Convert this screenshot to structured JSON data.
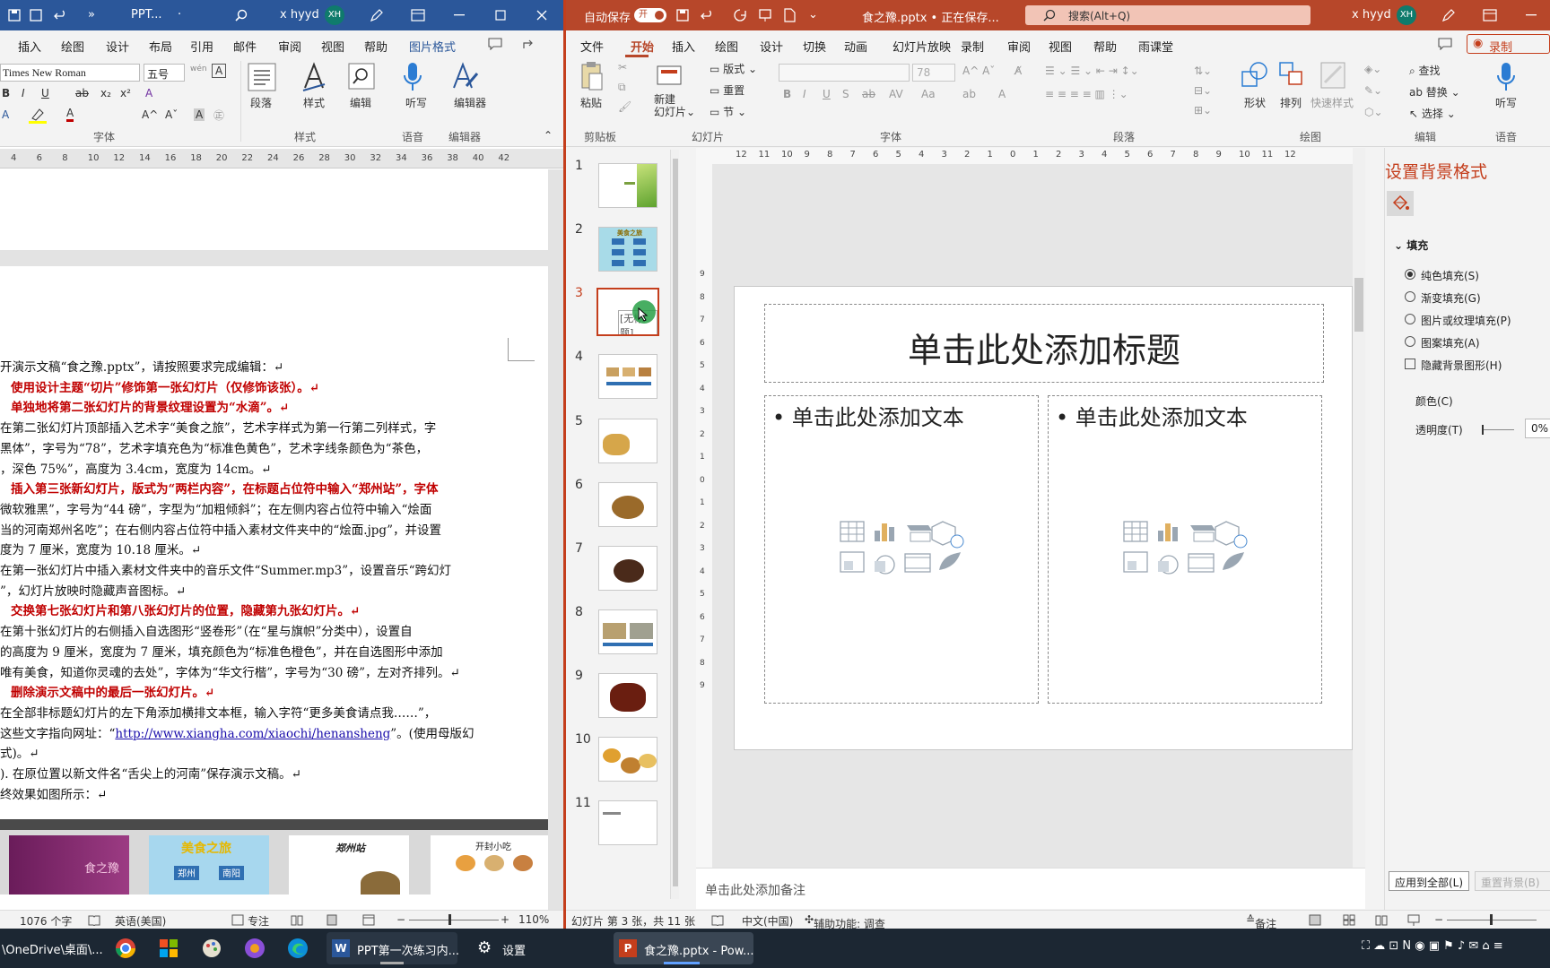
{
  "word": {
    "title": {
      "doc": "PPT...",
      "autosave_menu": "·",
      "user": "x hyyd",
      "avatar": "XH"
    },
    "menu": [
      "插入",
      "绘图",
      "设计",
      "布局",
      "引用",
      "邮件",
      "审阅",
      "视图",
      "帮助",
      "图片格式"
    ],
    "ribbon": {
      "font_name": "Times New Roman",
      "font_size": "五号",
      "groups": [
        "字体",
        "样式",
        "语音",
        "编辑器"
      ],
      "big_buttons": [
        "段落",
        "样式",
        "编辑",
        "听写",
        "编辑器"
      ],
      "tool_labels": [
        "B",
        "I",
        "U",
        "ab",
        "x₂",
        "x²",
        "A",
        "A",
        "A",
        "A"
      ]
    },
    "ruler": [
      "4",
      "6",
      "8",
      "10",
      "12",
      "14",
      "16",
      "18",
      "20",
      "22",
      "24",
      "26",
      "28",
      "30",
      "32",
      "34",
      "36",
      "38",
      "40",
      "42"
    ],
    "paragraphs": [
      {
        "text": "开演示文稿“食之豫.pptx”，请按照要求完成编辑：↵",
        "red": false
      },
      {
        "text": "使用设计主题“切片”修饰第一张幻灯片（仅修饰该张）。↵",
        "red": true,
        "prefix": "　",
        "suffix_plain": true
      },
      {
        "text": "单独地将第二张幻灯片的背景纹理设置为“水滴”。↵",
        "red": true
      },
      {
        "text": "在第二张幻灯片顶部插入艺术字“美食之旅”，艺术字样式为第一行第二列样式，字",
        "red": false
      },
      {
        "text": "黑体”，字号为“78”，艺术字填充色为“标准色黄色”，艺术字线条颜色为“茶色，",
        "red": false
      },
      {
        "text": "，深色 75%”，高度为 3.4cm，宽度为 14cm。↵",
        "red": false
      },
      {
        "text": "插入第三张新幻灯片，版式为“两栏内容”，在标题占位符中输入“郑州站”，字体",
        "red": true
      },
      {
        "text": "微软雅黑”，字号为“44 磅”，字型为“加粗倾斜”；在左侧内容占位符中输入“烩面",
        "red": false
      },
      {
        "text": "当的河南郑州名吃”；在右侧内容占位符中插入素材文件夹中的“烩面.jpg”，并设置",
        "red": false
      },
      {
        "text": "度为 7 厘米，宽度为 10.18 厘米。↵",
        "red": false
      },
      {
        "text": "在第一张幻灯片中插入素材文件夹中的音乐文件“Summer.mp3”，设置音乐“跨幻灯",
        "red": false
      },
      {
        "text": "”，幻灯片放映时隐藏声音图标。↵",
        "red": false
      },
      {
        "text": "交换第七张幻灯片和第八张幻灯片的位置，隐藏第九张幻灯片。↵",
        "red": true
      },
      {
        "text": "在第十张幻灯片的右侧插入自选图形“竖卷形”（在“星与旗帜”分类中），设置自",
        "red": false
      },
      {
        "text": "的高度为 9 厘米，宽度为 7 厘米，填充颜色为“标准色橙色”，并在自选图形中添加",
        "red": false
      },
      {
        "text": "唯有美食，知道你灵魂的去处”，字体为“华文行楷”，字号为“30 磅”，左对齐排列。↵",
        "red": false
      },
      {
        "text": "删除演示文稿中的最后一张幻灯片。↵",
        "red": true
      },
      {
        "text": "在全部非标题幻灯片的左下角添加横排文本框，输入字符“更多美食请点我……”，",
        "red": false
      },
      {
        "text": "这些文字指向网址：“",
        "red": false,
        "link": "http://www.xiangha.com/xiaochi/henansheng",
        "after": "”。(使用母版幻"
      },
      {
        "text": "式)。↵",
        "red": false
      },
      {
        "text": ").  在原位置以新文件名“舌尖上的河南”保存演示文稿。↵",
        "red": false
      },
      {
        "text": "终效果如图所示：↵",
        "red": false
      }
    ],
    "preview_labels": {
      "s1": "食之豫",
      "s2": "美食之旅",
      "s2a": "郑州",
      "s2b": "南阳",
      "s3": "郑州站",
      "s4": "开封小吃"
    },
    "status": {
      "words": "1076 个字",
      "lang": "英语(美国)",
      "focus": "专注",
      "zoom": "110%"
    }
  },
  "ppt": {
    "title": {
      "autosave": "自动保存",
      "toggle": "开",
      "doc": "食之豫.pptx • 正在保存...",
      "search": "搜索(Alt+Q)",
      "user": "x hyyd",
      "avatar": "XH"
    },
    "menu": [
      "文件",
      "开始",
      "插入",
      "绘图",
      "设计",
      "切换",
      "动画",
      "幻灯片放映",
      "录制",
      "审阅",
      "视图",
      "帮助",
      "雨课堂"
    ],
    "record": "录制",
    "ribbon": {
      "groups": [
        "剪贴板",
        "幻灯片",
        "字体",
        "段落",
        "绘图",
        "编辑",
        "语音"
      ],
      "paste": "粘贴",
      "new_slide": "新建\n幻灯片",
      "layout": "版式",
      "reset": "重置",
      "section": "节",
      "font_size": "78",
      "shape": "形状",
      "arrange": "排列",
      "quick_style": "快速样式",
      "find": "查找",
      "replace": "替换",
      "select": "选择",
      "dictate": "听写"
    },
    "thumbs": [
      "1",
      "2",
      "3",
      "4",
      "5",
      "6",
      "7",
      "8",
      "9",
      "10",
      "11"
    ],
    "thumb3_text": "[无标题]",
    "thumb2_title": "美食之旅",
    "ruler_h": [
      "12",
      "11",
      "10",
      "9",
      "8",
      "7",
      "6",
      "5",
      "4",
      "3",
      "2",
      "1",
      "0",
      "1",
      "2",
      "3",
      "4",
      "5",
      "6",
      "7",
      "8",
      "9",
      "10",
      "11",
      "12"
    ],
    "ruler_v": [
      "9",
      "8",
      "7",
      "6",
      "5",
      "4",
      "3",
      "2",
      "1",
      "0",
      "1",
      "2",
      "3",
      "4",
      "5",
      "6",
      "7",
      "8",
      "9"
    ],
    "slide": {
      "title": "单击此处添加标题",
      "left": "单击此处添加文本",
      "right": "单击此处添加文本"
    },
    "notes": "单击此处添加备注",
    "pane": {
      "title": "设置背景格式",
      "section": "填充",
      "options": [
        "纯色填充(S)",
        "渐变填充(G)",
        "图片或纹理填充(P)",
        "图案填充(A)"
      ],
      "checkbox": "隐藏背景图形(H)",
      "color": "颜色(C)",
      "transparency": "透明度(T)",
      "transparency_value": "0%",
      "apply_all": "应用到全部(L)",
      "reset": "重置背景(B)"
    },
    "status": {
      "slide": "幻灯片 第 3 张，共 11 张",
      "lang": "中文(中国)",
      "access": "辅助功能: 调查",
      "notes": "备注"
    }
  },
  "taskbar": {
    "path": "\\OneDrive\\桌面\\...",
    "word_app": "PPT第一次练习内...",
    "settings": "设置",
    "ppt_app": "食之豫.pptx - Pow..."
  }
}
